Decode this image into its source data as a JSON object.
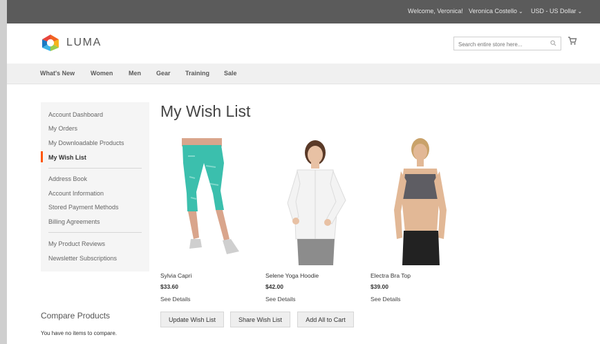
{
  "topbar": {
    "welcome": "Welcome, Veronica!",
    "user": "Veronica Costello",
    "currency": "USD - US Dollar"
  },
  "header": {
    "logo_text": "LUMA",
    "search_placeholder": "Search entire store here..."
  },
  "nav": {
    "items": [
      {
        "label": "What's New"
      },
      {
        "label": "Women"
      },
      {
        "label": "Men"
      },
      {
        "label": "Gear"
      },
      {
        "label": "Training"
      },
      {
        "label": "Sale"
      }
    ]
  },
  "sidebar": {
    "groups": [
      [
        "Account Dashboard",
        "My Orders",
        "My Downloadable Products",
        "My Wish List"
      ],
      [
        "Address Book",
        "Account Information",
        "Stored Payment Methods",
        "Billing Agreements"
      ],
      [
        "My Product Reviews",
        "Newsletter Subscriptions"
      ]
    ],
    "active": "My Wish List"
  },
  "compare": {
    "title": "Compare Products",
    "text": "You have no items to compare."
  },
  "main": {
    "title": "My Wish List",
    "products": [
      {
        "name": "Sylvia Capri",
        "price": "$33.60",
        "details": "See Details"
      },
      {
        "name": "Selene Yoga Hoodie",
        "price": "$42.00",
        "details": "See Details"
      },
      {
        "name": "Electra Bra Top",
        "price": "$39.00",
        "details": "See Details"
      }
    ],
    "buttons": {
      "update": "Update Wish List",
      "share": "Share Wish List",
      "add_all": "Add All to Cart"
    }
  },
  "colors": {
    "accent": "#ff5501",
    "topbar": "#5b5b5b",
    "nav_bg": "#f0f0f0"
  }
}
